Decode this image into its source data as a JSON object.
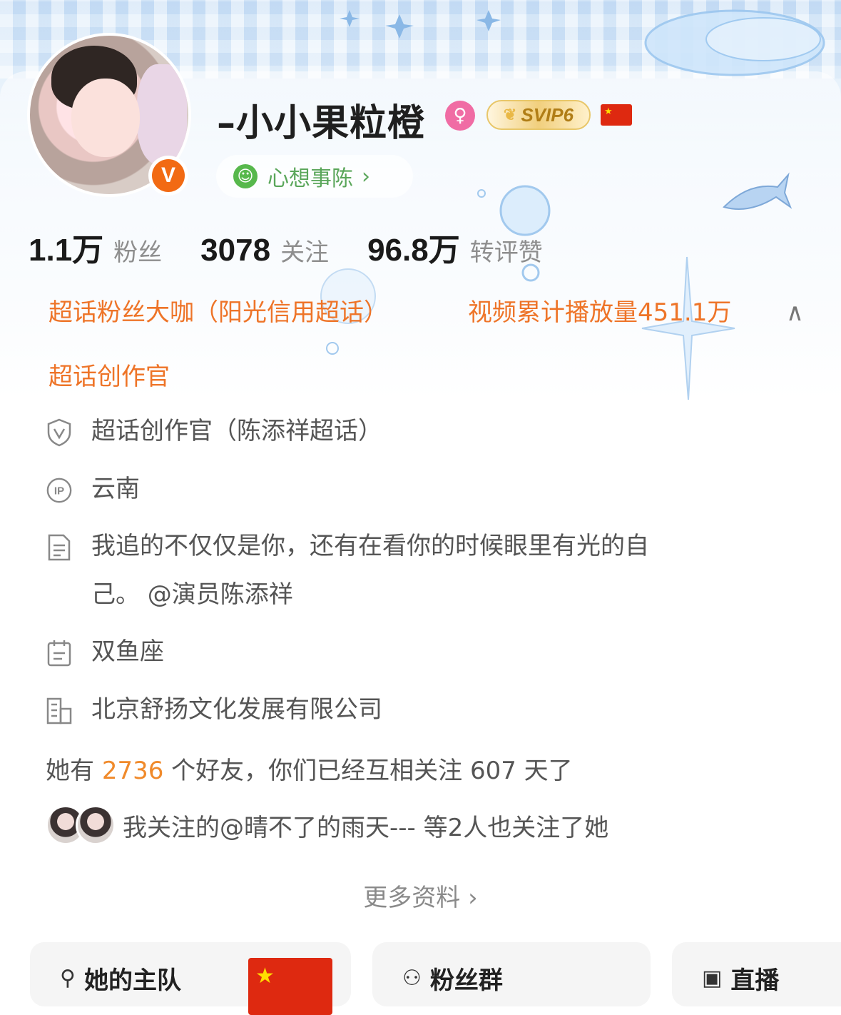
{
  "profile": {
    "name": "–小小果粒橙",
    "gender_icon": "female-icon",
    "vip_badge": "SVIP6",
    "flag_icon": "china-flag-icon",
    "verified_badge": "V",
    "mood": "心想事陈",
    "mood_chevron": "›"
  },
  "stats": [
    {
      "value": "1.1万",
      "label": "粉丝"
    },
    {
      "value": "3078",
      "label": "关注"
    },
    {
      "value": "96.8万",
      "label": "转评赞"
    }
  ],
  "tags": [
    "超话粉丝大咖（阳光信用超话）",
    "视频累计播放量451.1万",
    "超话创作官"
  ],
  "info": [
    {
      "icon": "shield-v-icon",
      "text": "超话创作官（陈添祥超话）"
    },
    {
      "icon": "ip-icon",
      "text": "云南"
    },
    {
      "icon": "document-icon",
      "text": "我追的不仅仅是你，还有在看你的时候眼里有光的自",
      "text2": "己。 @演员陈添祥"
    },
    {
      "icon": "calendar-icon",
      "text": "双鱼座"
    },
    {
      "icon": "building-icon",
      "text": "北京舒扬文化发展有限公司"
    }
  ],
  "friends": {
    "prefix": "她有 ",
    "count": "2736",
    "suffix": " 个好友，你们已经互相关注 607 天了"
  },
  "mutual": "我关注的@晴不了的雨天--- 等2人也关注了她",
  "more": "更多资料 ›",
  "tiles": [
    {
      "label": "她的主队",
      "icon": "team-icon"
    },
    {
      "label": "粉丝群",
      "icon": "group-icon"
    },
    {
      "label": "直播",
      "icon": "tv-icon"
    }
  ],
  "colors": {
    "accent_orange": "#ee7428",
    "friend_count": "#f08a2b",
    "mood_green": "#5aa65a",
    "verified": "#f26a13"
  }
}
